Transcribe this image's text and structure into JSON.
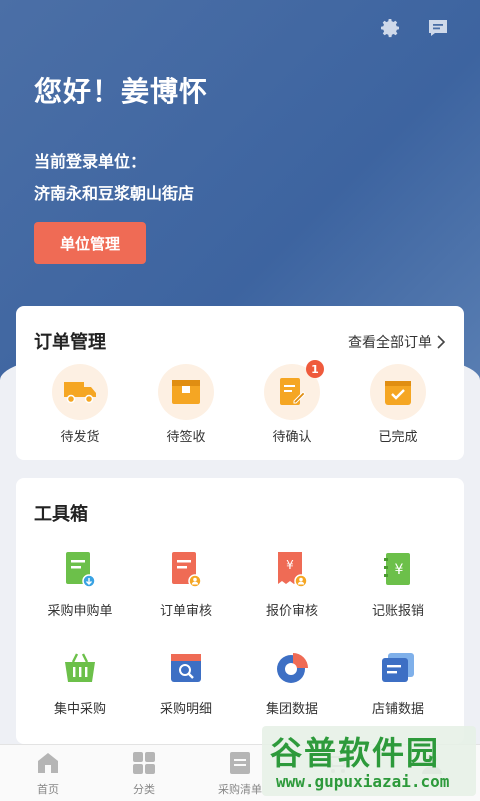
{
  "header": {
    "greeting": "您好！姜博怀",
    "unit_label": "当前登录单位：",
    "unit_name": "济南永和豆浆朝山街店",
    "unit_button": "单位管理",
    "settings_icon": "gear-icon",
    "message_icon": "message-icon"
  },
  "orders": {
    "title": "订单管理",
    "view_all": "查看全部订单",
    "items": [
      {
        "label": "待发货",
        "icon": "truck-icon"
      },
      {
        "label": "待签收",
        "icon": "box-icon"
      },
      {
        "label": "待确认",
        "icon": "edit-doc-icon",
        "badge": "1"
      },
      {
        "label": "已完成",
        "icon": "check-box-icon"
      }
    ]
  },
  "toolbox": {
    "title": "工具箱",
    "items": [
      {
        "label": "采购申购单",
        "icon": "purchase-request-icon"
      },
      {
        "label": "订单审核",
        "icon": "order-audit-icon"
      },
      {
        "label": "报价审核",
        "icon": "quote-audit-icon"
      },
      {
        "label": "记账报销",
        "icon": "bookkeeping-icon"
      },
      {
        "label": "集中采购",
        "icon": "basket-icon"
      },
      {
        "label": "采购明细",
        "icon": "purchase-detail-icon"
      },
      {
        "label": "集团数据",
        "icon": "pie-chart-icon"
      },
      {
        "label": "店铺数据",
        "icon": "store-data-icon"
      }
    ]
  },
  "tabbar": {
    "items": [
      {
        "label": "首页",
        "icon": "home-icon"
      },
      {
        "label": "分类",
        "icon": "grid-icon"
      },
      {
        "label": "采购清单",
        "icon": "list-icon"
      },
      {
        "label": "",
        "icon": "cart-icon"
      },
      {
        "label": "",
        "icon": "user-icon"
      }
    ]
  },
  "watermark": {
    "text": "谷普软件园",
    "url": "www.gupuxiazai.com"
  },
  "colors": {
    "hero": "#4b6fa6",
    "accent": "#ef6b55",
    "orange": "#f5a623",
    "green": "#5cb85c",
    "blue": "#3d6fc4"
  }
}
